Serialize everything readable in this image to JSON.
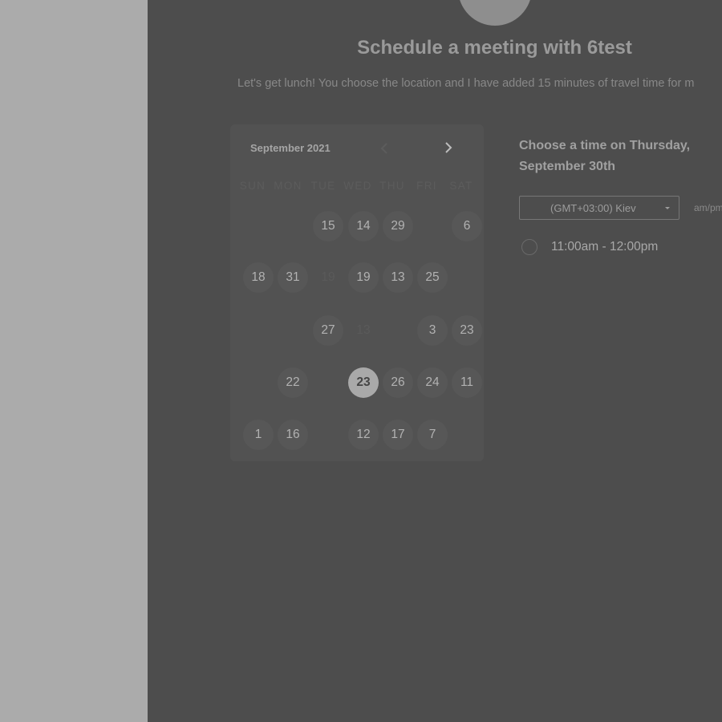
{
  "header": {
    "title": "Schedule a meeting with 6test",
    "description": "Let's get lunch! You choose the location and I have added 15 minutes of travel time for m"
  },
  "calendar": {
    "month_label": "September 2021",
    "prev_icon": "chevron-left-icon",
    "next_icon": "chevron-right-icon",
    "weekdays": [
      "SUN",
      "MON",
      "TUE",
      "WED",
      "THU",
      "FRI",
      "SAT"
    ],
    "weeks": [
      [
        {
          "label": "",
          "state": "empty"
        },
        {
          "label": "",
          "state": "empty"
        },
        {
          "label": "15",
          "state": "available"
        },
        {
          "label": "14",
          "state": "available"
        },
        {
          "label": "29",
          "state": "available"
        },
        {
          "label": "",
          "state": "empty"
        },
        {
          "label": "6",
          "state": "available"
        }
      ],
      [
        {
          "label": "18",
          "state": "available"
        },
        {
          "label": "31",
          "state": "available"
        },
        {
          "label": "19",
          "state": "disabled"
        },
        {
          "label": "19",
          "state": "available"
        },
        {
          "label": "13",
          "state": "available"
        },
        {
          "label": "25",
          "state": "available"
        },
        {
          "label": "",
          "state": "empty"
        }
      ],
      [
        {
          "label": "",
          "state": "empty"
        },
        {
          "label": "",
          "state": "empty"
        },
        {
          "label": "27",
          "state": "available"
        },
        {
          "label": "13",
          "state": "disabled"
        },
        {
          "label": "",
          "state": "empty"
        },
        {
          "label": "3",
          "state": "available"
        },
        {
          "label": "23",
          "state": "available"
        }
      ],
      [
        {
          "label": "",
          "state": "empty"
        },
        {
          "label": "22",
          "state": "available"
        },
        {
          "label": "",
          "state": "empty"
        },
        {
          "label": "23",
          "state": "selected"
        },
        {
          "label": "26",
          "state": "available"
        },
        {
          "label": "24",
          "state": "available"
        },
        {
          "label": "11",
          "state": "available"
        }
      ],
      [
        {
          "label": "1",
          "state": "available"
        },
        {
          "label": "16",
          "state": "available"
        },
        {
          "label": "",
          "state": "empty"
        },
        {
          "label": "12",
          "state": "available"
        },
        {
          "label": "17",
          "state": "available"
        },
        {
          "label": "7",
          "state": "available"
        },
        {
          "label": "",
          "state": "empty"
        }
      ]
    ]
  },
  "time_panel": {
    "heading": "Choose a time on Thursday, September 30th",
    "timezone_value": "(GMT+03:00) Kiev",
    "ampm_label": "am/pm",
    "slots": [
      {
        "label": "11:00am - 12:00pm",
        "selected": false
      }
    ]
  },
  "colors": {
    "page_background": "#4d4d4d",
    "left_panel": "#ababab",
    "selected_day": "#a9a9a9"
  }
}
